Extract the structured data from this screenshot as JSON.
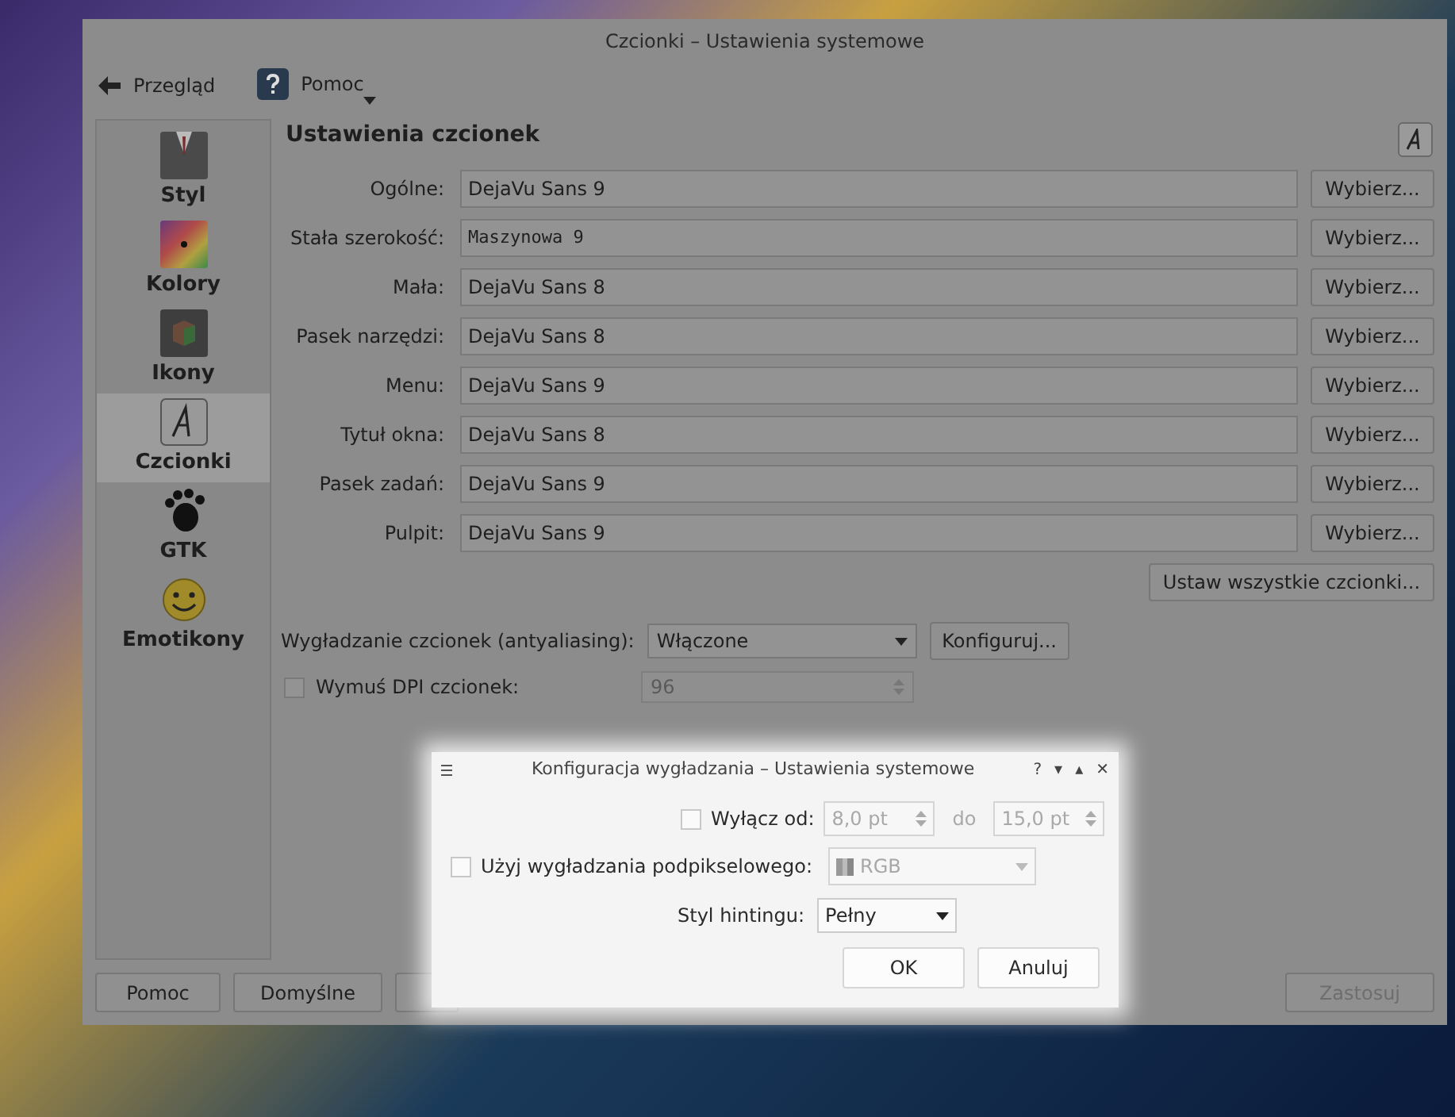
{
  "window": {
    "title": "Czcionki – Ustawienia systemowe"
  },
  "toolbar": [
    {
      "label": "Przegląd",
      "kind": "back"
    },
    {
      "label": "Pomoc",
      "kind": "help"
    }
  ],
  "sidebar": {
    "items": [
      {
        "label": "Styl",
        "selected": false
      },
      {
        "label": "Kolory",
        "selected": false
      },
      {
        "label": "Ikony",
        "selected": false
      },
      {
        "label": "Czcionki",
        "selected": true
      },
      {
        "label": "GTK",
        "selected": false
      },
      {
        "label": "Emotikony",
        "selected": false
      }
    ]
  },
  "heading": "Ustawienia czcionek",
  "fonts": [
    {
      "label": "Ogólne:",
      "value": "DejaVu Sans 9",
      "button": "Wybierz..."
    },
    {
      "label": "Stała szerokość:",
      "value": "Maszynowa  9",
      "button": "Wybierz...",
      "mono": true
    },
    {
      "label": "Mała:",
      "value": "DejaVu Sans 8",
      "button": "Wybierz..."
    },
    {
      "label": "Pasek narzędzi:",
      "value": "DejaVu Sans 8",
      "button": "Wybierz..."
    },
    {
      "label": "Menu:",
      "value": "DejaVu Sans 9",
      "button": "Wybierz..."
    },
    {
      "label": "Tytuł okna:",
      "value": "DejaVu Sans 8",
      "button": "Wybierz..."
    },
    {
      "label": "Pasek zadań:",
      "value": "DejaVu Sans 9",
      "button": "Wybierz..."
    },
    {
      "label": "Pulpit:",
      "value": "DejaVu Sans 9",
      "button": "Wybierz..."
    }
  ],
  "set_all_button": "Ustaw wszystkie czcionki...",
  "antialiasing": {
    "label": "Wygładzanie czcionek (antyaliasing):",
    "value": "Włączone",
    "button": "Konfiguruj..."
  },
  "force_dpi": {
    "label": "Wymuś DPI czcionek:",
    "checked": false,
    "value": "96"
  },
  "bottom_buttons": [
    {
      "label": "Pomoc",
      "disabled": false
    },
    {
      "label": "Domyślne",
      "disabled": false
    },
    {
      "label": "Zastosuj",
      "disabled": true
    }
  ],
  "dialog": {
    "title": "Konfiguracja wygładzania – Ustawienia systemowe",
    "title_controls": [
      "?",
      "▾",
      "▴",
      "✕"
    ],
    "exclude": {
      "label": "Wyłącz od:",
      "checked": false,
      "from": "8,0 pt",
      "to_label": "do",
      "to": "15,0 pt"
    },
    "subpixel": {
      "label": "Użyj wygładzania podpikselowego:",
      "checked": false,
      "value": "RGB"
    },
    "hinting": {
      "label": "Styl hintingu:",
      "value": "Pełny"
    },
    "buttons": [
      "OK",
      "Anuluj"
    ]
  }
}
